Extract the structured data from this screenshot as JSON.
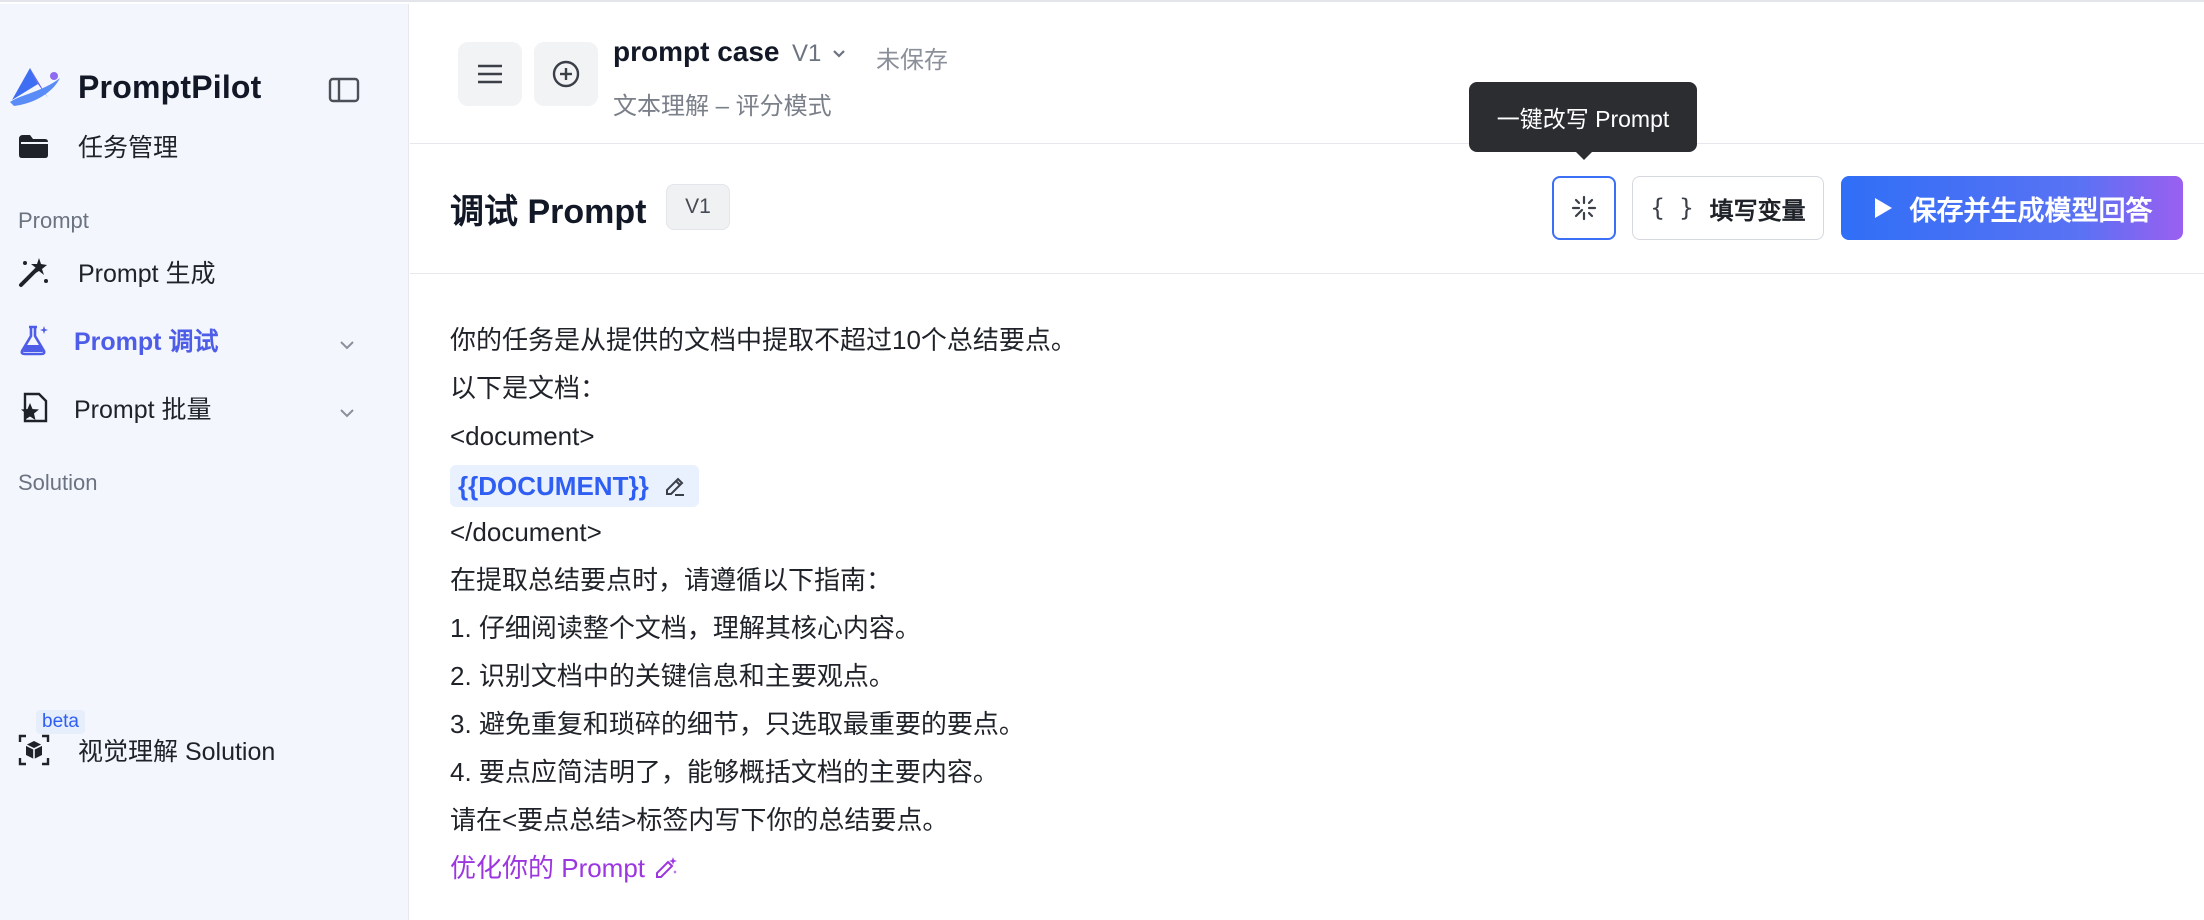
{
  "brand": {
    "name": "PromptPilot"
  },
  "sidebar": {
    "items": [
      {
        "label": "任务管理",
        "icon": "folder-icon"
      },
      {
        "label": "Prompt 生成",
        "icon": "magic-wand-icon"
      },
      {
        "label": "Prompt 调试",
        "icon": "flask-icon",
        "active": true,
        "chevron": "chevron-down-icon"
      },
      {
        "label": "Prompt 批量",
        "icon": "document-star-icon",
        "chevron": "chevron-down-icon"
      },
      {
        "label": "视觉理解 Solution",
        "icon": "cube-scan-icon",
        "badge": "beta"
      }
    ],
    "sections": [
      "Prompt",
      "Solution"
    ]
  },
  "header": {
    "case_name": "prompt case",
    "version": "V1",
    "status": "未保存",
    "subtitle": "文本理解 – 评分模式",
    "menu_icon": "hamburger-icon",
    "add_icon": "plus-circle-icon"
  },
  "tooltip": {
    "text": "一键改写 Prompt"
  },
  "toolbar": {
    "title": "调试 Prompt",
    "version_badge": "V1",
    "rewrite_icon": "sparkle-icon",
    "fill_vars_braces": "{ }",
    "fill_vars_label": "填写变量",
    "generate_label": "保存并生成模型回答",
    "generate_icon": "play-icon"
  },
  "prompt": {
    "line1": "你的任务是从提供的文档中提取不超过10个总结要点。",
    "line2": "以下是文档：",
    "line3": "<document>",
    "variable": "{{DOCUMENT}}",
    "line5": "</document>",
    "line6": "在提取总结要点时，请遵循以下指南：",
    "line7": "1. 仔细阅读整个文档，理解其核心内容。",
    "line8": "2. 识别文档中的关键信息和主要观点。",
    "line9": "3. 避免重复和琐碎的细节，只选取最重要的要点。",
    "line10": "4. 要点应简洁明了，能够概括文档的主要内容。",
    "line11": "请在<要点总结>标签内写下你的总结要点。",
    "optimize_label": "优化你的 Prompt"
  },
  "colors": {
    "accent": "#4e5de8",
    "link_blue": "#2f5ef2",
    "optimize_purple": "#9c36e0",
    "sidebar_bg": "#f3f6fd"
  }
}
